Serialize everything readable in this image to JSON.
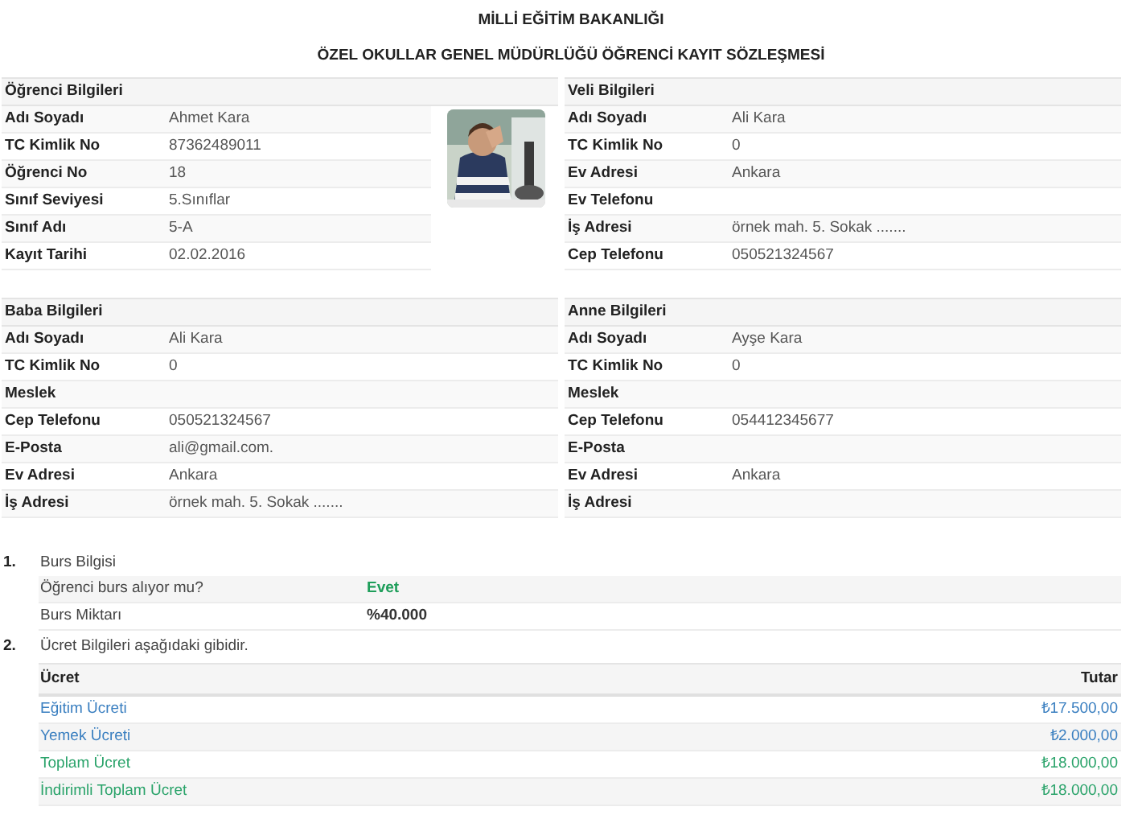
{
  "header": {
    "ministry": "MİLLİ EĞİTİM BAKANLIĞI",
    "title": "ÖZEL OKULLAR GENEL MÜDÜRLÜĞÜ ÖĞRENCİ KAYIT SÖZLEŞMESİ"
  },
  "student": {
    "heading": "Öğrenci Bilgileri",
    "fields": [
      {
        "label": "Adı Soyadı",
        "value": "Ahmet Kara"
      },
      {
        "label": "TC Kimlik No",
        "value": "87362489011"
      },
      {
        "label": "Öğrenci No",
        "value": "18"
      },
      {
        "label": "Sınıf Seviyesi",
        "value": "5.Sınıflar"
      },
      {
        "label": "Sınıf Adı",
        "value": "5-A"
      },
      {
        "label": "Kayıt Tarihi",
        "value": "02.02.2016"
      }
    ]
  },
  "guardian": {
    "heading": "Veli Bilgileri",
    "fields": [
      {
        "label": "Adı Soyadı",
        "value": "Ali Kara"
      },
      {
        "label": "TC Kimlik No",
        "value": "0"
      },
      {
        "label": "Ev Adresi",
        "value": "Ankara"
      },
      {
        "label": "Ev Telefonu"
      },
      {
        "label": "İş Adresi",
        "value": "örnek mah. 5. Sokak ......."
      },
      {
        "label": "Cep Telefonu",
        "value": "050521324567"
      }
    ]
  },
  "father": {
    "heading": "Baba Bilgileri",
    "fields": [
      {
        "label": "Adı Soyadı",
        "value": "Ali Kara"
      },
      {
        "label": "TC Kimlik No",
        "value": "0"
      },
      {
        "label": "Meslek"
      },
      {
        "label": "Cep Telefonu",
        "value": "050521324567"
      },
      {
        "label": "E-Posta",
        "value": "ali@gmail.com."
      },
      {
        "label": "Ev Adresi",
        "value": "Ankara"
      },
      {
        "label": "İş Adresi",
        "value": "örnek mah. 5. Sokak ......."
      }
    ]
  },
  "mother": {
    "heading": "Anne Bilgileri",
    "fields": [
      {
        "label": "Adı Soyadı",
        "value": "Ayşe Kara"
      },
      {
        "label": "TC Kimlik No",
        "value": "0"
      },
      {
        "label": "Meslek"
      },
      {
        "label": "Cep Telefonu",
        "value": "054412345677"
      },
      {
        "label": "E-Posta"
      },
      {
        "label": "Ev Adresi",
        "value": "Ankara"
      },
      {
        "label": "İş Adresi"
      }
    ]
  },
  "scholarship": {
    "number": "1.",
    "title": "Burs Bilgisi",
    "rows": [
      {
        "label": "Öğrenci burs alıyor mu?",
        "value": "Evet",
        "color": "#1e9e5a"
      },
      {
        "label": "Burs Miktarı",
        "value": "%40.000",
        "color": "#333333"
      }
    ]
  },
  "fees": {
    "number": "2.",
    "title": "Ücret Bilgileri aşağıdaki gibidir.",
    "columns": [
      "Ücret",
      "Tutar"
    ],
    "rows": [
      {
        "label": "Eğitim Ücreti",
        "amount": "₺17.500,00",
        "color": "#3a7fc0"
      },
      {
        "label": "Yemek Ücreti",
        "amount": "₺2.000,00",
        "color": "#3a7fc0"
      },
      {
        "label": "Toplam Ücret",
        "amount": "₺18.000,00",
        "color": "#2aa36a"
      },
      {
        "label": "İndirimli Toplam Ücret",
        "amount": "₺18.000,00",
        "color": "#2aa36a"
      }
    ]
  }
}
